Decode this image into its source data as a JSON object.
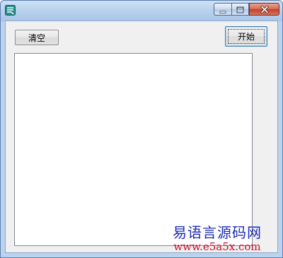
{
  "window": {
    "title": "",
    "caption_buttons": {
      "minimize_icon": "minimize-icon",
      "maximize_icon": "maximize-icon",
      "close_icon": "close-icon"
    }
  },
  "form": {
    "clear_button_label": "清空",
    "start_button_label": "开始",
    "output_text": ""
  },
  "watermark": {
    "title": "易语言源码网",
    "url": "www.e5a5x.com"
  },
  "colors": {
    "close_button": "#c0412a",
    "watermark_title": "#1b2bb6",
    "watermark_url": "#c8102e"
  }
}
